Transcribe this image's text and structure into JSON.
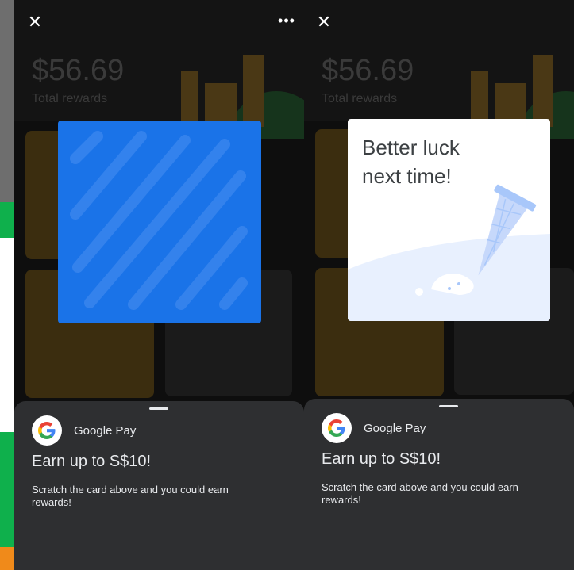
{
  "screens": [
    {
      "header": {
        "amount": "$56.69",
        "amount_label": "Total rewards"
      },
      "close_label": "✕",
      "more_label": "•••",
      "sheet": {
        "app_name": "Google Pay",
        "title": "Earn up to S$10!",
        "description": "Scratch the card above and you could earn rewards!"
      }
    },
    {
      "header": {
        "amount": "$56.69",
        "amount_label": "Total rewards"
      },
      "close_label": "✕",
      "result_text": "Better luck\nnext time!",
      "sheet": {
        "app_name": "Google Pay",
        "title": "Earn up to S$10!",
        "description": "Scratch the card above and you could earn rewards!"
      }
    }
  ],
  "colors": {
    "scratch_card": "#1a73e8",
    "sheet_bg": "#2e2f31",
    "ice_cream_cone": "#a8c7fa",
    "google_blue": "#4285f4",
    "google_red": "#ea4335",
    "google_yellow": "#fbbc05",
    "google_green": "#34a853"
  },
  "icons": [
    "close-icon",
    "more-icon",
    "google-logo-icon",
    "castle-illustration",
    "dropped-ice-cream-illustration"
  ]
}
